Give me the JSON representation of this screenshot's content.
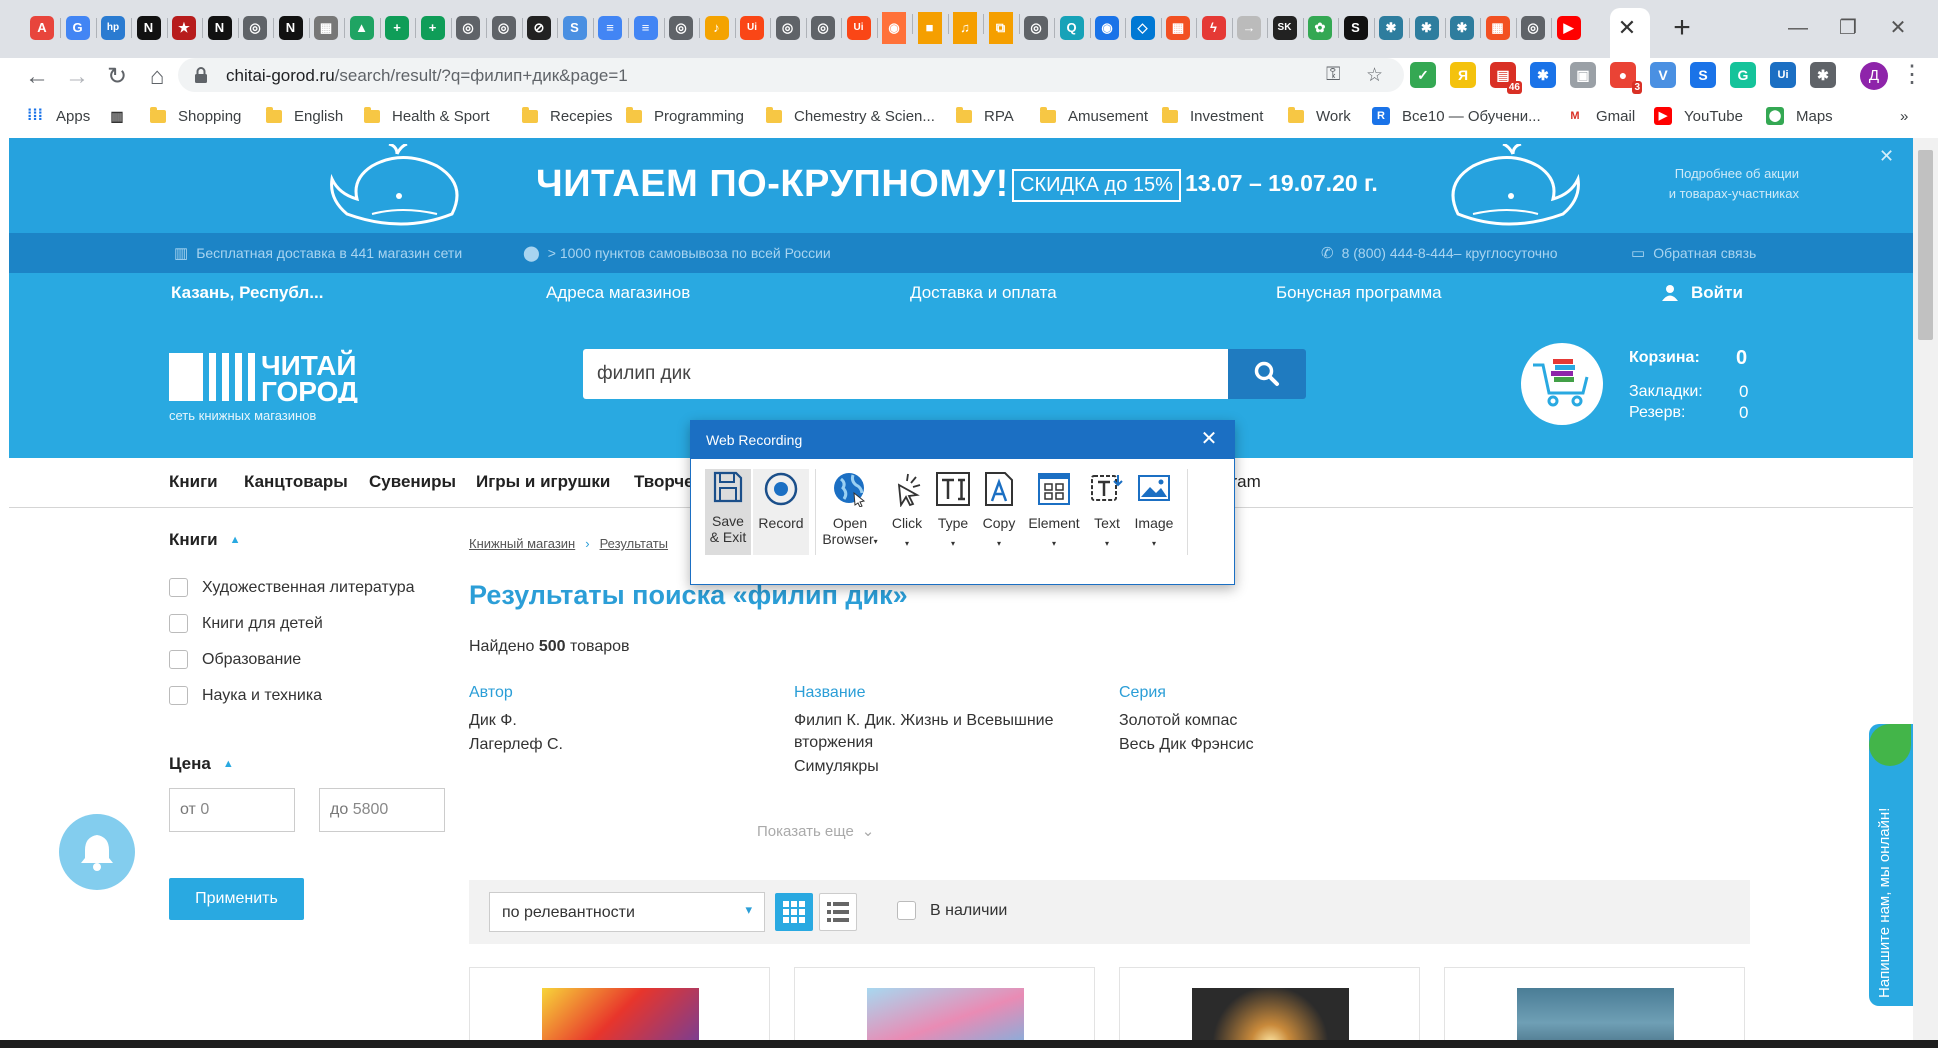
{
  "browser": {
    "tab_favicons": [
      {
        "icon": "avast-icon",
        "bg": "#e8453c",
        "glyph": "A"
      },
      {
        "icon": "google-translate-icon",
        "bg": "#4285f4",
        "glyph": "G"
      },
      {
        "icon": "hp-icon",
        "bg": "#2a7bd1",
        "glyph": "hp"
      },
      {
        "icon": "notion-icon",
        "bg": "#111111",
        "glyph": "N"
      },
      {
        "icon": "star-icon",
        "bg": "#b71c1c",
        "glyph": "★"
      },
      {
        "icon": "notion-icon",
        "bg": "#111111",
        "glyph": "N"
      },
      {
        "icon": "globe-icon",
        "bg": "#5f6368",
        "glyph": "◎"
      },
      {
        "icon": "notion-icon",
        "bg": "#111111",
        "glyph": "N"
      },
      {
        "icon": "calculator-icon",
        "bg": "#777777",
        "glyph": "▦"
      },
      {
        "icon": "google-drive-icon",
        "bg": "#1fa463",
        "glyph": "▲"
      },
      {
        "icon": "google-sheets-icon",
        "bg": "#0f9d58",
        "glyph": "+"
      },
      {
        "icon": "google-sheets-icon",
        "bg": "#0f9d58",
        "glyph": "+"
      },
      {
        "icon": "globe-icon",
        "bg": "#5f6368",
        "glyph": "◎"
      },
      {
        "icon": "globe-icon",
        "bg": "#5f6368",
        "glyph": "◎"
      },
      {
        "icon": "link-icon",
        "bg": "#222222",
        "glyph": "⊘"
      },
      {
        "icon": "skype-icon",
        "bg": "#4a90e2",
        "glyph": "S"
      },
      {
        "icon": "google-docs-icon",
        "bg": "#4285f4",
        "glyph": "≡"
      },
      {
        "icon": "google-docs-icon",
        "bg": "#4285f4",
        "glyph": "≡"
      },
      {
        "icon": "globe-icon",
        "bg": "#5f6368",
        "glyph": "◎"
      },
      {
        "icon": "music-icon",
        "bg": "#f4a300",
        "glyph": "♪"
      },
      {
        "icon": "uipath-icon",
        "bg": "#fa4616",
        "glyph": "Ui"
      },
      {
        "icon": "globe-icon",
        "bg": "#5f6368",
        "glyph": "◎"
      },
      {
        "icon": "globe-icon",
        "bg": "#5f6368",
        "glyph": "◎"
      },
      {
        "icon": "uipath-icon",
        "bg": "#fa4616",
        "glyph": "Ui"
      },
      {
        "icon": "firefox-icon",
        "bg": "#ff7139",
        "glyph": "◉"
      },
      {
        "icon": "video-icon",
        "bg": "#f59f00",
        "glyph": "■"
      },
      {
        "icon": "microphone-icon",
        "bg": "#f59f00",
        "glyph": "♫"
      },
      {
        "icon": "screenshot-icon",
        "bg": "#f59f00",
        "glyph": "⧉"
      },
      {
        "icon": "globe-icon",
        "bg": "#5f6368",
        "glyph": "◎"
      },
      {
        "icon": "quizlet-icon",
        "bg": "#17a2b8",
        "glyph": "Q"
      },
      {
        "icon": "target-icon",
        "bg": "#1a73e8",
        "glyph": "◉"
      },
      {
        "icon": "azure-devops-icon",
        "bg": "#0078d4",
        "glyph": "◇"
      },
      {
        "icon": "microsoft-icon",
        "bg": "#f25022",
        "glyph": "▦"
      },
      {
        "icon": "lightning-icon",
        "bg": "#e53935",
        "glyph": "ϟ"
      },
      {
        "icon": "arrow-icon",
        "bg": "#bbbbbb",
        "glyph": "→"
      },
      {
        "icon": "sk-icon",
        "bg": "#222222",
        "glyph": "SK"
      },
      {
        "icon": "pinwheel-icon",
        "bg": "#34a853",
        "glyph": "✿"
      },
      {
        "icon": "s-icon",
        "bg": "#111111",
        "glyph": "S"
      },
      {
        "icon": "puzzle-icon",
        "bg": "#2e7d9e",
        "glyph": "✱"
      },
      {
        "icon": "puzzle-icon",
        "bg": "#2e7d9e",
        "glyph": "✱"
      },
      {
        "icon": "puzzle-icon",
        "bg": "#2e7d9e",
        "glyph": "✱"
      },
      {
        "icon": "microsoft-icon",
        "bg": "#f25022",
        "glyph": "▦"
      },
      {
        "icon": "globe-icon",
        "bg": "#5f6368",
        "glyph": "◎"
      },
      {
        "icon": "youtube-icon",
        "bg": "#ff0000",
        "glyph": "▶"
      }
    ],
    "active_tab_close": "✕",
    "new_tab": "+",
    "window_controls": {
      "minimize": "—",
      "maximize": "❐",
      "close": "✕"
    },
    "nav": {
      "back": "←",
      "forward": "→",
      "reload": "↻",
      "home": "⌂"
    },
    "url_host": "chitai-gorod.ru",
    "url_path": "/search/result/?q=филип+дик&page=1",
    "extensions": [
      {
        "icon": "shield-icon",
        "bg": "#34a853",
        "glyph": "✓",
        "badge": ""
      },
      {
        "icon": "yandex-icon",
        "bg": "#f4c20d",
        "glyph": "Я",
        "badge": ""
      },
      {
        "icon": "calendar-icon",
        "bg": "#d93025",
        "glyph": "▤",
        "badge": "46"
      },
      {
        "icon": "gear-icon",
        "bg": "#1a73e8",
        "glyph": "✱",
        "badge": ""
      },
      {
        "icon": "image-icon",
        "bg": "#9aa0a6",
        "glyph": "▣",
        "badge": ""
      },
      {
        "icon": "record-icon",
        "bg": "#ea4335",
        "glyph": "●",
        "badge": "3"
      },
      {
        "icon": "v-icon",
        "bg": "#4a90e2",
        "glyph": "V",
        "badge": ""
      },
      {
        "icon": "s-icon",
        "bg": "#1a73e8",
        "glyph": "S",
        "badge": ""
      },
      {
        "icon": "grammarly-icon",
        "bg": "#15c39a",
        "glyph": "G",
        "badge": ""
      },
      {
        "icon": "uipath-icon",
        "bg": "#1b6fc3",
        "glyph": "Ui",
        "badge": ""
      },
      {
        "icon": "puzzle-icon",
        "bg": "#5f6368",
        "glyph": "✱",
        "badge": ""
      }
    ],
    "profile_initial": "Д",
    "bookmarks": [
      {
        "label": "Apps",
        "type": "apps"
      },
      {
        "label": "",
        "type": "barcode"
      },
      {
        "label": "Shopping",
        "type": "folder"
      },
      {
        "label": "English",
        "type": "folder"
      },
      {
        "label": "Health & Sport",
        "type": "folder"
      },
      {
        "label": "Recepies",
        "type": "folder"
      },
      {
        "label": "Programming",
        "type": "folder"
      },
      {
        "label": "Chemestry & Scien...",
        "type": "folder"
      },
      {
        "label": "RPA",
        "type": "folder"
      },
      {
        "label": "Amusement",
        "type": "folder"
      },
      {
        "label": "Investment",
        "type": "folder"
      },
      {
        "label": "Work",
        "type": "folder"
      },
      {
        "label": "Все10 — Обучени...",
        "type": "site",
        "bg": "#1a73e8",
        "glyph": "R"
      },
      {
        "label": "Gmail",
        "type": "site",
        "bg": "#ffffff",
        "glyph": "M",
        "fg": "#d93025"
      },
      {
        "label": "YouTube",
        "type": "site",
        "bg": "#ff0000",
        "glyph": "▶"
      },
      {
        "label": "Maps",
        "type": "site",
        "bg": "#34a853",
        "glyph": "⬤"
      }
    ],
    "bookmarks_more": "»"
  },
  "promo": {
    "title": "ЧИТАЕМ ПО-КРУПНОМУ!",
    "discount": "СКИДКА до 15%",
    "dates": "13.07 – 19.07.20 г.",
    "more_line1": "Подробнее об акции",
    "more_line2": "и товарах-участниках",
    "close": "✕"
  },
  "info_strip": {
    "delivery": "Бесплатная доставка в 441 магазин сети",
    "pickup": "> 1000 пунктов самовывоза по всей России",
    "phone": "8 (800) 444-8-444",
    "phone_note": " – круглосуточно",
    "feedback": "Обратная связь"
  },
  "nav_strip": {
    "city": "Казань, Республ...",
    "stores": "Адреса магазинов",
    "delivery": "Доставка и оплата",
    "bonus": "Бонусная программа",
    "login": "Войти"
  },
  "header": {
    "logo_line1": "ЧИТАЙ",
    "logo_line2": "ГОРОД",
    "logo_sub": "сеть книжных магазинов",
    "search_value": "филип дик",
    "cart_label": "Корзина:",
    "cart_count": "0",
    "bookmarks_label": "Закладки:",
    "bookmarks_count": "0",
    "reserve_label": "Резерв:",
    "reserve_count": "0"
  },
  "categories": [
    "Книги",
    "Канцтовары",
    "Сувениры",
    "Игры и игрушки",
    "Творче"
  ],
  "categories_tail": "gram",
  "sidebar": {
    "books_heading": "Книги",
    "book_filters": [
      "Художественная литература",
      "Книги для детей",
      "Образование",
      "Наука и техника"
    ],
    "price_heading": "Цена",
    "price_from_label": "от",
    "price_from_value": "0",
    "price_to_label": "до",
    "price_to_value": "5800",
    "apply": "Применить"
  },
  "results": {
    "breadcrumb_home": "Книжный магазин",
    "breadcrumb_sep": "›",
    "breadcrumb_current": "Результаты",
    "title": "Результаты поиска «филип дик»",
    "found_prefix": "Найдено ",
    "found_count": "500",
    "found_suffix": " товаров",
    "author_head": "Автор",
    "authors": [
      "Дик Ф.",
      "Лагерлеф С."
    ],
    "title_head": "Название",
    "titles": [
      "Филип К. Дик. Жизнь и Всевышние вторжения",
      "Симулякры"
    ],
    "series_head": "Серия",
    "series": [
      "Золотой компас",
      "Весь Дик Фрэнсис"
    ],
    "show_more": "Показать еще",
    "sort_value": "по релевантности",
    "in_stock": "В наличии"
  },
  "chat": {
    "label": "Напишите нам, мы онлайн!"
  },
  "recorder": {
    "title": "Web Recording",
    "close": "✕",
    "save_line1": "Save",
    "save_line2": "& Exit",
    "record": "Record",
    "open_line1": "Open",
    "open_line2": "Browser",
    "click": "Click",
    "type": "Type",
    "copy": "Copy",
    "element": "Element",
    "text": "Text",
    "image": "Image"
  },
  "colors": {
    "brand_blue": "#29a9e1",
    "promo_blue": "#26a2de",
    "strip_blue": "#1c84c6",
    "recorder_blue": "#1b6fc3",
    "link_blue": "#2b9ed7"
  }
}
